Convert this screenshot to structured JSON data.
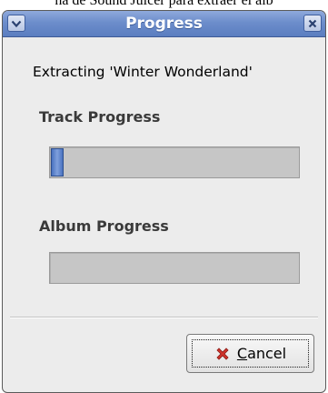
{
  "caption": "na de Sound Juicer para extraer el álb",
  "window": {
    "title": "Progress",
    "menu_icon": "chevron-down-icon",
    "close_icon": "close-icon"
  },
  "message": "Extracting 'Winter Wonderland'",
  "track_progress": {
    "label": "Track Progress",
    "fraction": 0.05
  },
  "album_progress": {
    "label": "Album Progress",
    "fraction": 0
  },
  "cancel_button": {
    "mnemonic": "C",
    "label_rest": "ancel",
    "icon": "cancel-icon",
    "icon_color": "#d0332b"
  },
  "colors": {
    "titlebar": "#6c8dcb",
    "progress_fill": "#4a72c0"
  }
}
